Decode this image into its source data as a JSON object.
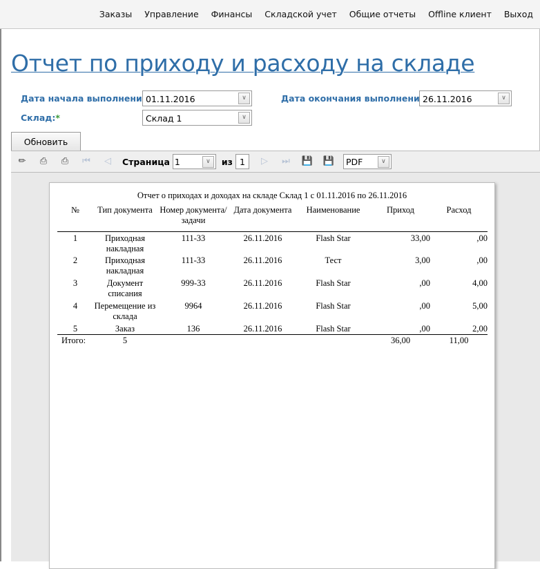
{
  "nav": [
    "Заказы",
    "Управление",
    "Финансы",
    "Складской учет",
    "Общие отчеты",
    "Offline клиент",
    "Выход"
  ],
  "title": "Отчет по приходу и расходу на складе",
  "form": {
    "start_label": "Дата начала выполнения:",
    "start_value": "01.11.2016",
    "end_label": "Дата окончания выполнения:",
    "end_value": "26.11.2016",
    "warehouse_label": "Склад:",
    "warehouse_value": "Склад 1",
    "required_mark": "*",
    "refresh": "Обновить"
  },
  "toolbar": {
    "page_label": "Страница",
    "page_value": "1",
    "of_label": "из",
    "total_pages": "1",
    "format": "PDF",
    "icons": [
      "find-icon",
      "print-icon",
      "print-layout-icon",
      "first-page-icon",
      "prev-page-icon",
      "next-page-icon",
      "last-page-icon",
      "save-icon",
      "export-icon"
    ]
  },
  "report": {
    "title": "Отчет о приходах и доходах на складе Склад 1 с 01.11.2016 по 26.11.2016",
    "columns": [
      "№",
      "Тип документа",
      "Номер документа/задачи",
      "Дата документа",
      "Наименование",
      "Приход",
      "Расход"
    ],
    "rows": [
      [
        "1",
        "Приходная накладная",
        "111-33",
        "26.11.2016",
        "Flash Star",
        "33,00",
        ",00"
      ],
      [
        "2",
        "Приходная накладная",
        "111-33",
        "26.11.2016",
        "Тест",
        "3,00",
        ",00"
      ],
      [
        "3",
        "Документ списания",
        "999-33",
        "26.11.2016",
        "Flash Star",
        ",00",
        "4,00"
      ],
      [
        "4",
        "Перемещение из склада",
        "9964",
        "26.11.2016",
        "Flash Star",
        ",00",
        "5,00"
      ],
      [
        "5",
        "Заказ",
        "136",
        "26.11.2016",
        "Flash Star",
        ",00",
        "2,00"
      ]
    ],
    "total": {
      "label": "Итого:",
      "count": "5",
      "income": "36,00",
      "expense": "11,00"
    }
  }
}
